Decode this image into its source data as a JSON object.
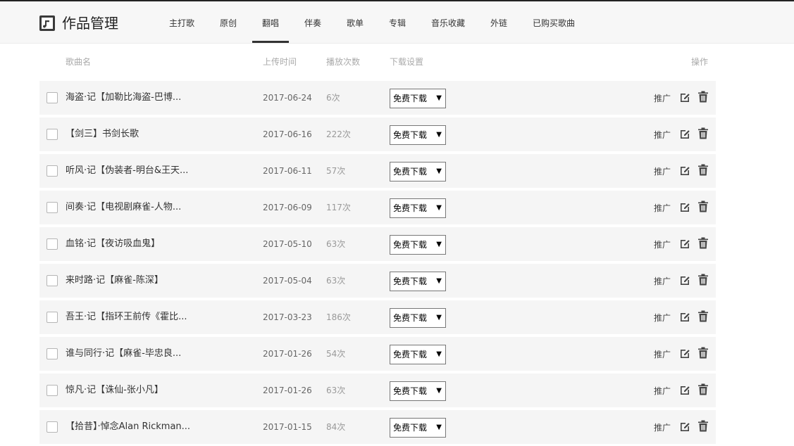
{
  "header": {
    "title": "作品管理",
    "logo_icon": "music-note-icon",
    "tabs": [
      {
        "label": "主打歌",
        "active": false
      },
      {
        "label": "原创",
        "active": false
      },
      {
        "label": "翻唱",
        "active": true
      },
      {
        "label": "伴奏",
        "active": false
      },
      {
        "label": "歌单",
        "active": false
      },
      {
        "label": "专辑",
        "active": false
      },
      {
        "label": "音乐收藏",
        "active": false
      },
      {
        "label": "外链",
        "active": false
      },
      {
        "label": "已购买歌曲",
        "active": false
      }
    ]
  },
  "table": {
    "columns": {
      "name": "歌曲名",
      "upload_time": "上传时间",
      "plays": "播放次数",
      "download": "下载设置",
      "actions": "操作"
    },
    "rows": [
      {
        "name": "海盗·记【加勒比海盗-巴博...",
        "date": "2017-06-24",
        "plays": "6次",
        "download": "免费下载",
        "promote": "推广"
      },
      {
        "name": "【剑三】书剑长歌",
        "date": "2017-06-16",
        "plays": "222次",
        "download": "免费下载",
        "promote": "推广"
      },
      {
        "name": "听风·记【伪装者-明台&王天...",
        "date": "2017-06-11",
        "plays": "57次",
        "download": "免费下载",
        "promote": "推广"
      },
      {
        "name": "间奏·记【电视剧麻雀-人物...",
        "date": "2017-06-09",
        "plays": "117次",
        "download": "免费下载",
        "promote": "推广"
      },
      {
        "name": "血铭·记【夜访吸血鬼】",
        "date": "2017-05-10",
        "plays": "63次",
        "download": "免费下载",
        "promote": "推广"
      },
      {
        "name": "来时路·记【麻雀-陈深】",
        "date": "2017-05-04",
        "plays": "63次",
        "download": "免费下载",
        "promote": "推广"
      },
      {
        "name": "吾王·记【指环王前传《霍比...",
        "date": "2017-03-23",
        "plays": "186次",
        "download": "免费下载",
        "promote": "推广"
      },
      {
        "name": "谁与同行·记【麻雀-毕忠良...",
        "date": "2017-01-26",
        "plays": "54次",
        "download": "免费下载",
        "promote": "推广"
      },
      {
        "name": "惊凡·记【诛仙-张小凡】",
        "date": "2017-01-26",
        "plays": "63次",
        "download": "免费下载",
        "promote": "推广"
      },
      {
        "name": "【拾昔】·悼念Alan Rickman...",
        "date": "2017-01-15",
        "plays": "84次",
        "download": "免费下载",
        "promote": "推广"
      }
    ],
    "row_icons": {
      "edit": "edit-icon",
      "delete": "trash-icon"
    }
  }
}
